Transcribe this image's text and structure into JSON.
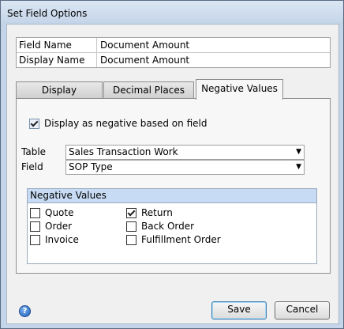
{
  "window": {
    "title": "Set Field Options"
  },
  "fields": [
    {
      "label": "Field Name",
      "value": "Document Amount"
    },
    {
      "label": "Display Name",
      "value": "Document Amount"
    }
  ],
  "tabs": [
    {
      "label": "Display",
      "active": false
    },
    {
      "label": "Decimal Places",
      "active": false
    },
    {
      "label": "Negative Values",
      "active": true
    }
  ],
  "negative_tab": {
    "display_negative": {
      "label": "Display as negative based on field",
      "checked": true
    },
    "table": {
      "label": "Table",
      "value": "Sales Transaction Work"
    },
    "field": {
      "label": "Field",
      "value": "SOP Type"
    },
    "values_box": {
      "header": "Negative Values",
      "items": [
        {
          "label": "Quote",
          "checked": false
        },
        {
          "label": "Order",
          "checked": false
        },
        {
          "label": "Invoice",
          "checked": false
        },
        {
          "label": "Return",
          "checked": true
        },
        {
          "label": "Back Order",
          "checked": false
        },
        {
          "label": "Fulfillment Order",
          "checked": false
        }
      ]
    }
  },
  "buttons": {
    "save": "Save",
    "cancel": "Cancel"
  },
  "icons": {
    "help": "help-icon",
    "dropdown": "chevron-down-icon"
  }
}
